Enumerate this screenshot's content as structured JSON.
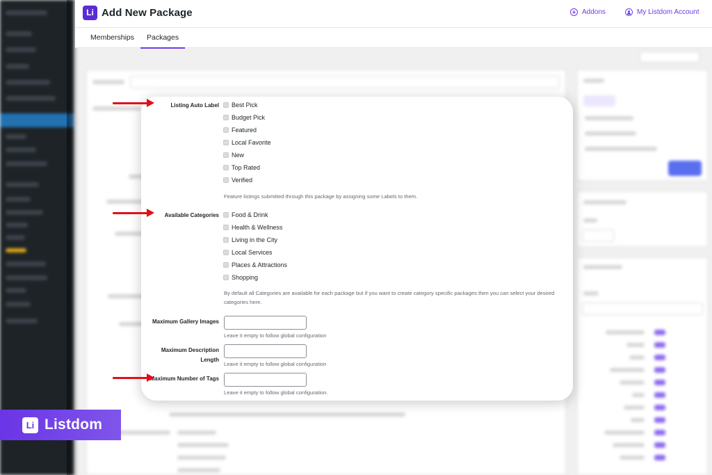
{
  "header": {
    "logo_text": "Li",
    "title": "Add New Package",
    "addons_label": "Addons",
    "account_label": "My Listdom Account"
  },
  "tabs": [
    {
      "label": "Memberships",
      "active": false
    },
    {
      "label": "Packages",
      "active": true
    }
  ],
  "form": {
    "auto_label": {
      "label": "Listing Auto Label",
      "options": [
        "Best Pick",
        "Budget Pick",
        "Featured",
        "Local Favorite",
        "New",
        "Top Rated",
        "Verified"
      ],
      "help": "Feature listings submitted through this package by assigning some Labels to them."
    },
    "categories": {
      "label": "Available Categories",
      "options": [
        "Food & Drink",
        "Health & Wellness",
        "Living in the City",
        "Local Services",
        "Places & Attractions",
        "Shopping"
      ],
      "help": "By default all Categories are available for each package but if you want to create category specific packages then you can select your desired categories here."
    },
    "gallery": {
      "label": "Maximum Gallery Images",
      "value": "",
      "help": "Leave it empty to follow global configuration"
    },
    "description": {
      "label": "Maximum Description Length",
      "value": "",
      "help": "Leave it empty to follow global configuration"
    },
    "tags": {
      "label": "Maximum Number of Tags",
      "value": "",
      "help": "Leave it empty to follow global configuration."
    }
  },
  "brand": {
    "logo_text": "Li",
    "name": "Listdom"
  },
  "colors": {
    "accent": "#6f3ce4",
    "arrow": "#e0101a",
    "wp_sidebar": "#1d2327"
  }
}
